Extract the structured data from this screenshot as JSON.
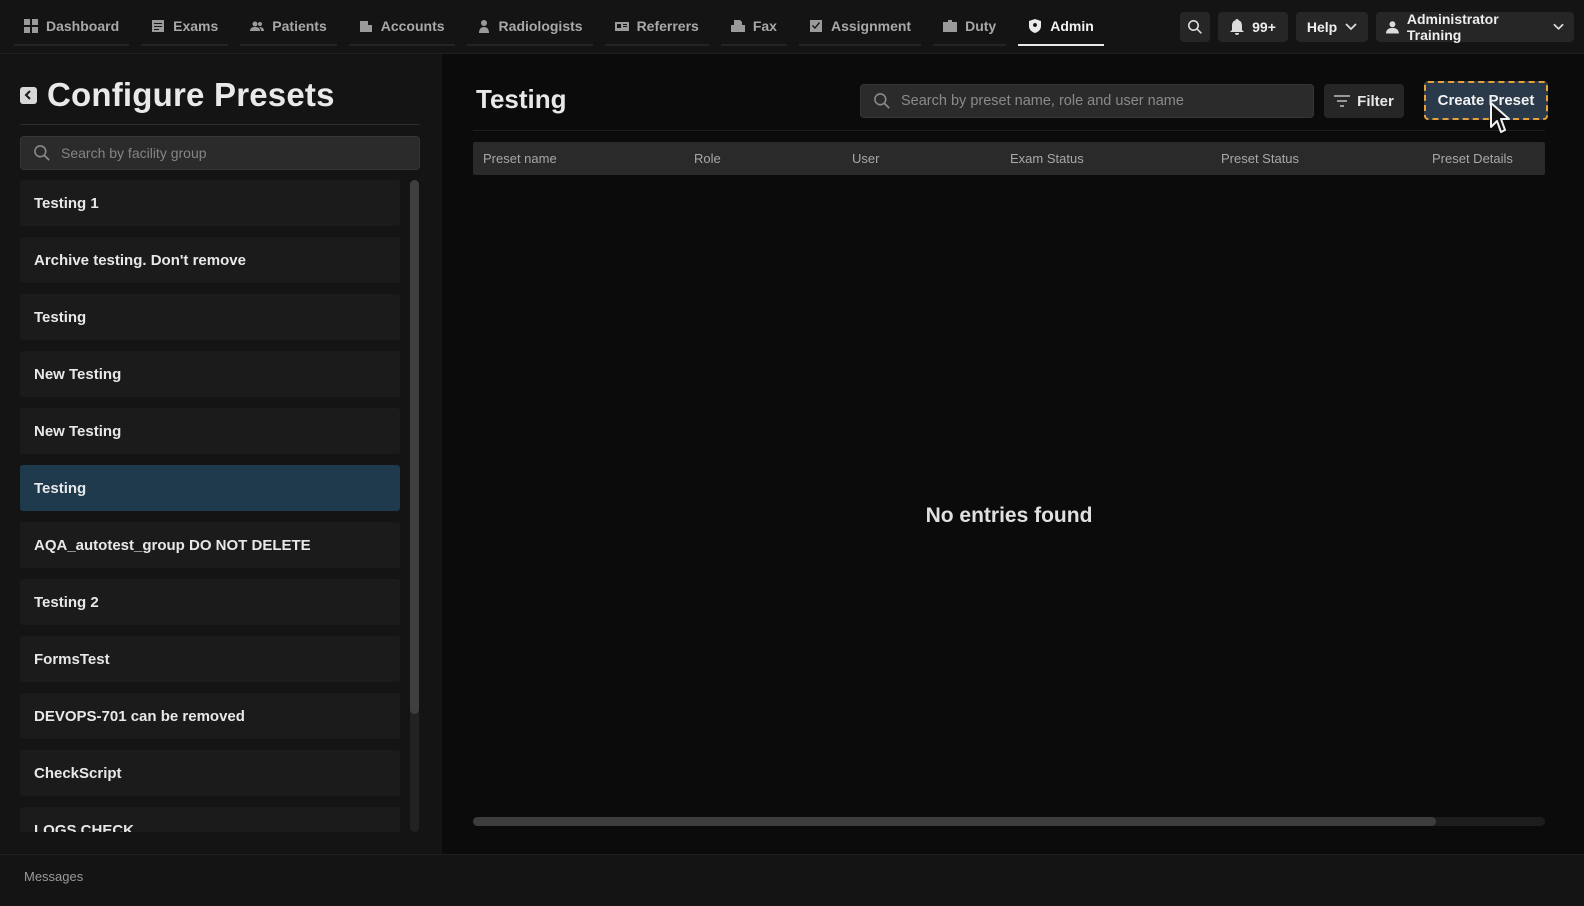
{
  "nav": {
    "items": [
      {
        "label": "Dashboard",
        "icon": "dashboard-icon"
      },
      {
        "label": "Exams",
        "icon": "exams-icon"
      },
      {
        "label": "Patients",
        "icon": "patients-icon"
      },
      {
        "label": "Accounts",
        "icon": "accounts-icon"
      },
      {
        "label": "Radiologists",
        "icon": "radiologist-icon"
      },
      {
        "label": "Referrers",
        "icon": "referrers-icon"
      },
      {
        "label": "Fax",
        "icon": "fax-icon"
      },
      {
        "label": "Assignment",
        "icon": "assignment-icon"
      },
      {
        "label": "Duty",
        "icon": "duty-icon"
      },
      {
        "label": "Admin",
        "icon": "shield-icon"
      }
    ],
    "active": "Admin",
    "notifications_badge": "99+",
    "help_label": "Help",
    "user_label": "Administrator Training"
  },
  "sidebar": {
    "title": "Configure Presets",
    "search_placeholder": "Search by facility group",
    "groups": [
      {
        "label": "Testing 1"
      },
      {
        "label": "Archive testing. Don't remove"
      },
      {
        "label": "Testing"
      },
      {
        "label": "New Testing"
      },
      {
        "label": "New Testing"
      },
      {
        "label": "Testing",
        "selected": true
      },
      {
        "label": "AQA_autotest_group DO NOT DELETE"
      },
      {
        "label": "Testing 2"
      },
      {
        "label": "FormsTest"
      },
      {
        "label": "DEVOPS-701 can be removed"
      },
      {
        "label": "CheckScript"
      },
      {
        "label": "LOGS CHECK"
      }
    ]
  },
  "main": {
    "title": "Testing",
    "search_placeholder": "Search by preset name, role and user name",
    "filter_label": "Filter",
    "create_label": "Create Preset",
    "columns": [
      "Preset name",
      "Role",
      "User",
      "Exam Status",
      "Preset Status",
      "Preset Details"
    ],
    "empty_message": "No entries found"
  },
  "footer": {
    "label": "Messages"
  },
  "colors": {
    "accent_selected": "#1e3a4c",
    "create_button_outline": "#e8a13a"
  }
}
